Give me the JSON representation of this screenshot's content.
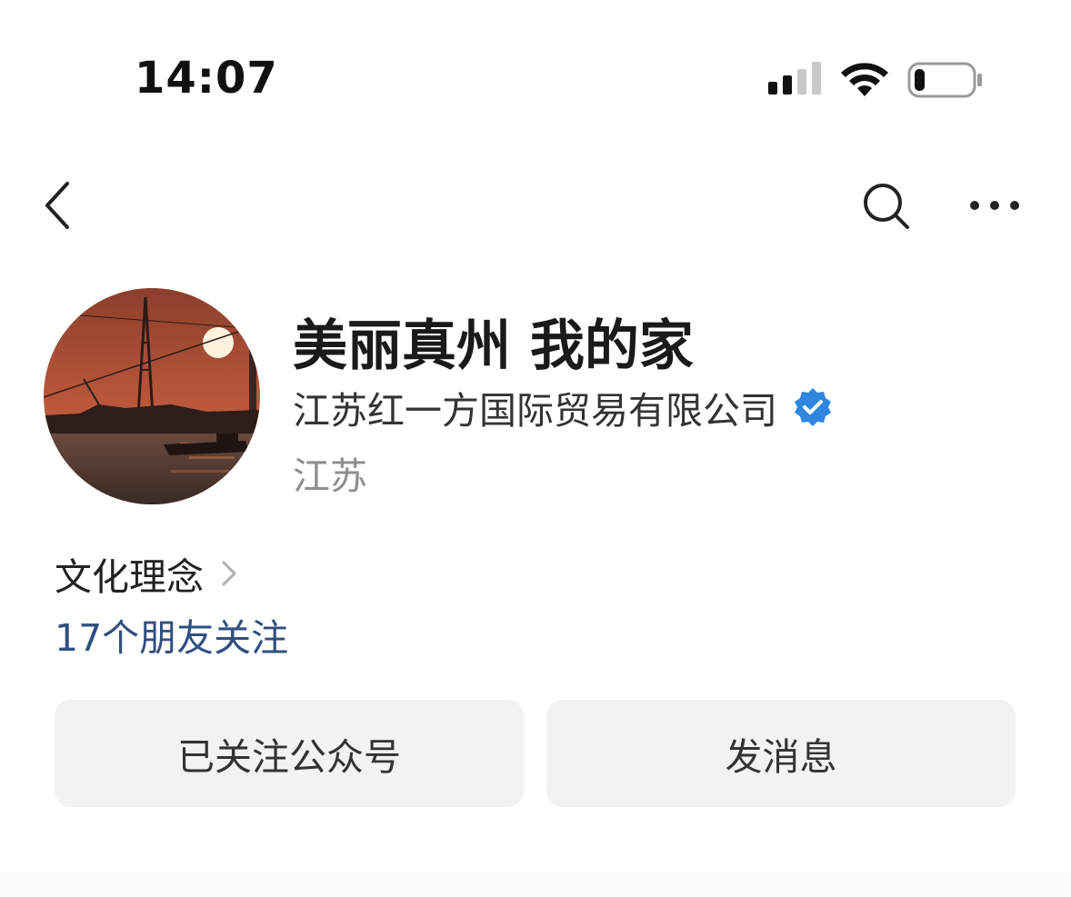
{
  "status_bar": {
    "time": "14:07",
    "signal_icon": "cellular-signal-icon",
    "wifi_icon": "wifi-icon",
    "battery_icon": "battery-low-icon",
    "battery_level": 0.15
  },
  "nav": {
    "back_icon": "chevron-left-icon",
    "search_icon": "search-icon",
    "more_icon": "more-dots-icon"
  },
  "profile": {
    "avatar_icon": "avatar-sunset-photo",
    "name": "美丽真州 我的家",
    "company": "江苏红一方国际贸易有限公司",
    "verified_icon": "verified-badge-icon",
    "verified_color": "#2e86de",
    "region": "江苏"
  },
  "links": {
    "culture": "文化理念",
    "friends_follow": "17个朋友关注",
    "friends_color": "#2f4f7f"
  },
  "actions": {
    "followed": "已关注公众号",
    "message": "发消息"
  }
}
